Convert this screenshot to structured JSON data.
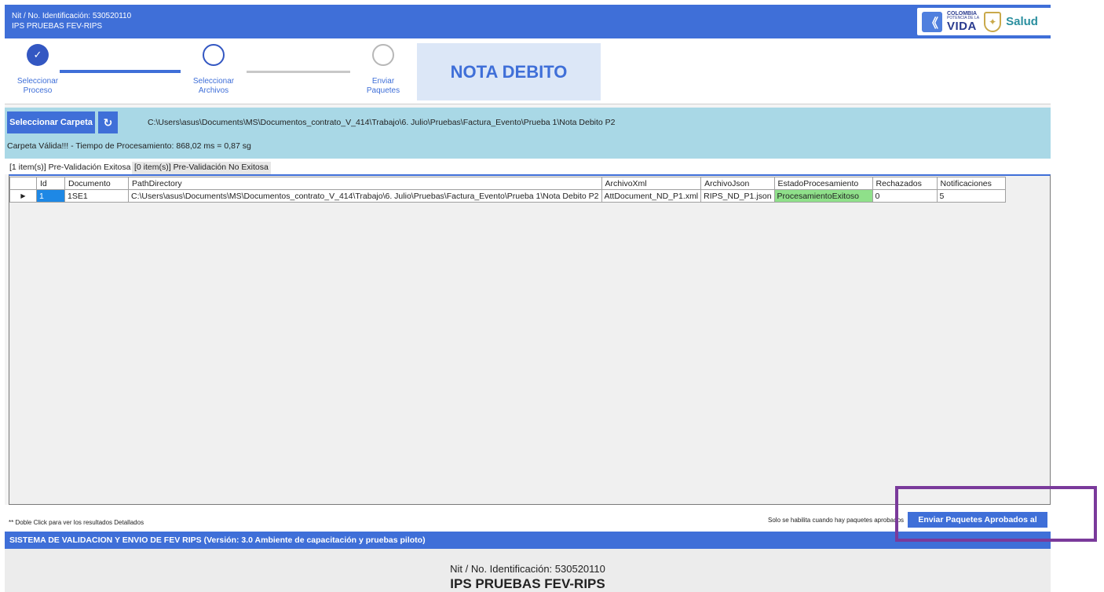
{
  "header": {
    "nit": "Nit / No. Identificación: 530520110",
    "ips": "IPS PRUEBAS FEV-RIPS",
    "logo": {
      "colombia": "COLOMBIA",
      "potencia": "POTENCIA DE LA",
      "vida": "VIDA",
      "salud": "Salud"
    }
  },
  "steps": [
    {
      "line1": "Seleccionar",
      "line2": "Proceso",
      "state": "done"
    },
    {
      "line1": "Seleccionar",
      "line2": "Archivos",
      "state": "current"
    },
    {
      "line1": "Enviar",
      "line2": "Paquetes",
      "state": "pending"
    }
  ],
  "process_title": "NOTA DEBITO",
  "folder": {
    "select_label": "Seleccionar Carpeta",
    "path": "C:\\Users\\asus\\Documents\\MS\\Documentos_contrato_V_414\\Trabajo\\6. Julio\\Pruebas\\Factura_Evento\\Prueba 1\\Nota Debito P2",
    "status": "Carpeta Válida!!! - Tiempo de Procesamiento: 868,02 ms = 0,87 sg"
  },
  "tabs": [
    {
      "label": "[1 item(s)] Pre-Validación Exitosa"
    },
    {
      "label": "[0 item(s)] Pre-Validación No Exitosa"
    }
  ],
  "grid": {
    "columns": [
      "Id",
      "Documento",
      "PathDirectory",
      "ArchivoXml",
      "ArchivoJson",
      "EstadoProcesamiento",
      "Rechazados",
      "Notificaciones"
    ],
    "rows": [
      {
        "id": "1",
        "documento": "1SE1",
        "path": "C:\\Users\\asus\\Documents\\MS\\Documentos_contrato_V_414\\Trabajo\\6. Julio\\Pruebas\\Factura_Evento\\Prueba 1\\Nota Debito P2",
        "xml": "AttDocument_ND_P1.xml",
        "json": "RIPS_ND_P1.json",
        "estado": "ProcesamientoExitoso",
        "rechazados": "0",
        "notificaciones": "5"
      }
    ]
  },
  "actions": {
    "hint": "** Doble Click para ver los resultados Detallados",
    "only_hint": "Solo se habilita cuando hay paquetes aprobados",
    "send_label": "Enviar Paquetes Aprobados al"
  },
  "footer": {
    "system": "SISTEMA DE VALIDACION Y ENVIO DE FEV RIPS  (Versión: 3.0 Ambiente de capacitación y pruebas piloto)",
    "nit": "Nit / No. Identificación: 530520110",
    "ips": "IPS PRUEBAS FEV-RIPS"
  },
  "colors": {
    "primary": "#3f6fd8",
    "success": "#8fe08a",
    "panel": "#a9d8e6",
    "highlight": "#7a3a9b"
  }
}
